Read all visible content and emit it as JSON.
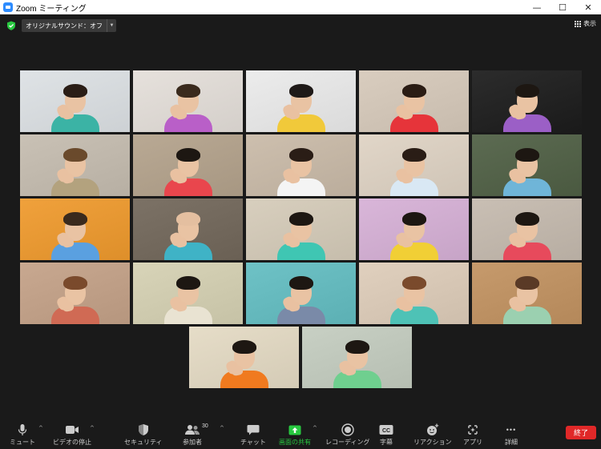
{
  "window": {
    "title": "Zoom ミーティング",
    "controls": {
      "minimize": "—",
      "maximize": "☐",
      "close": "✕"
    }
  },
  "header": {
    "audio_badge": "オリジナルサウンド：オフ",
    "view_label": "表示"
  },
  "colors": {
    "active_speaker_outline": "#d6f04a",
    "share_green": "#28c840",
    "end_red": "#e02828",
    "toolbar_bg": "#1a1a1a"
  },
  "participants": [
    {
      "bg": "#dfe3e6",
      "hair": "#2a1d16",
      "shirt": "#3bb3a5"
    },
    {
      "bg": "#e6e1dc",
      "hair": "#3a2a1d",
      "shirt": "#b95fc8"
    },
    {
      "bg": "#ececec",
      "hair": "#1f1a18",
      "shirt": "#f1c93a"
    },
    {
      "bg": "#d9cdbf",
      "hair": "#2a1c14",
      "shirt": "#e6343a"
    },
    {
      "bg": "#2c2c2c",
      "hair": "#1d1712",
      "shirt": "#9b5fc6"
    },
    {
      "bg": "#c9c1b5",
      "hair": "#6a4a2c",
      "shirt": "#b3a27e"
    },
    {
      "bg": "#b9a994",
      "hair": "#1d1712",
      "shirt": "#e9464d"
    },
    {
      "bg": "#cdbfae",
      "hair": "#2a1d16",
      "shirt": "#f4f4f4"
    },
    {
      "bg": "#e1d6c8",
      "hair": "#2a1d16",
      "shirt": "#d9e8f4"
    },
    {
      "bg": "#5c6b52",
      "hair": "#1d1712",
      "shirt": "#6fb5d8"
    },
    {
      "bg": "#f0a13c",
      "hair": "#3a2a1d",
      "shirt": "#5aa0e0"
    },
    {
      "bg": "#7c7266",
      "hair": "#e4bfa0",
      "shirt": "#3fb3c6"
    },
    {
      "bg": "#d8cfbe",
      "hair": "#1d1712",
      "shirt": "#3fc6b3"
    },
    {
      "bg": "#d9b6d9",
      "hair": "#1d1712",
      "shirt": "#f1cf35"
    },
    {
      "bg": "#c9bfb4",
      "hair": "#1d1712",
      "shirt": "#e74a5c"
    },
    {
      "bg": "#c8a890",
      "hair": "#7a4a2c",
      "shirt": "#d06a54"
    },
    {
      "bg": "#d8d4b8",
      "hair": "#1d1712",
      "shirt": "#e9e3d2"
    },
    {
      "bg": "#6ec2c6",
      "hair": "#1d1712",
      "shirt": "#7a8aa8"
    },
    {
      "bg": "#e0d0be",
      "hair": "#7a4a2c",
      "shirt": "#4ec2b6"
    },
    {
      "bg": "#c69a6c",
      "hair": "#5a3a26",
      "shirt": "#9bd0b0"
    },
    {
      "bg": "#e6ddc8",
      "hair": "#1d1712",
      "shirt": "#f07a1f"
    },
    {
      "bg": "#c8d0c4",
      "hair": "#1d1712",
      "shirt": "#6fcf8f"
    }
  ],
  "toolbar": {
    "mute": "ミュート",
    "video": "ビデオの停止",
    "security": "セキュリティ",
    "participants": "参加者",
    "participants_count": "30",
    "chat": "チャット",
    "share": "画面の共有",
    "record": "レコーディング",
    "captions": "字幕",
    "reactions": "リアクション",
    "apps": "アプリ",
    "more": "詳細",
    "end": "終了",
    "caret": "^",
    "more_dots": "•••",
    "cc_text": "CC"
  }
}
